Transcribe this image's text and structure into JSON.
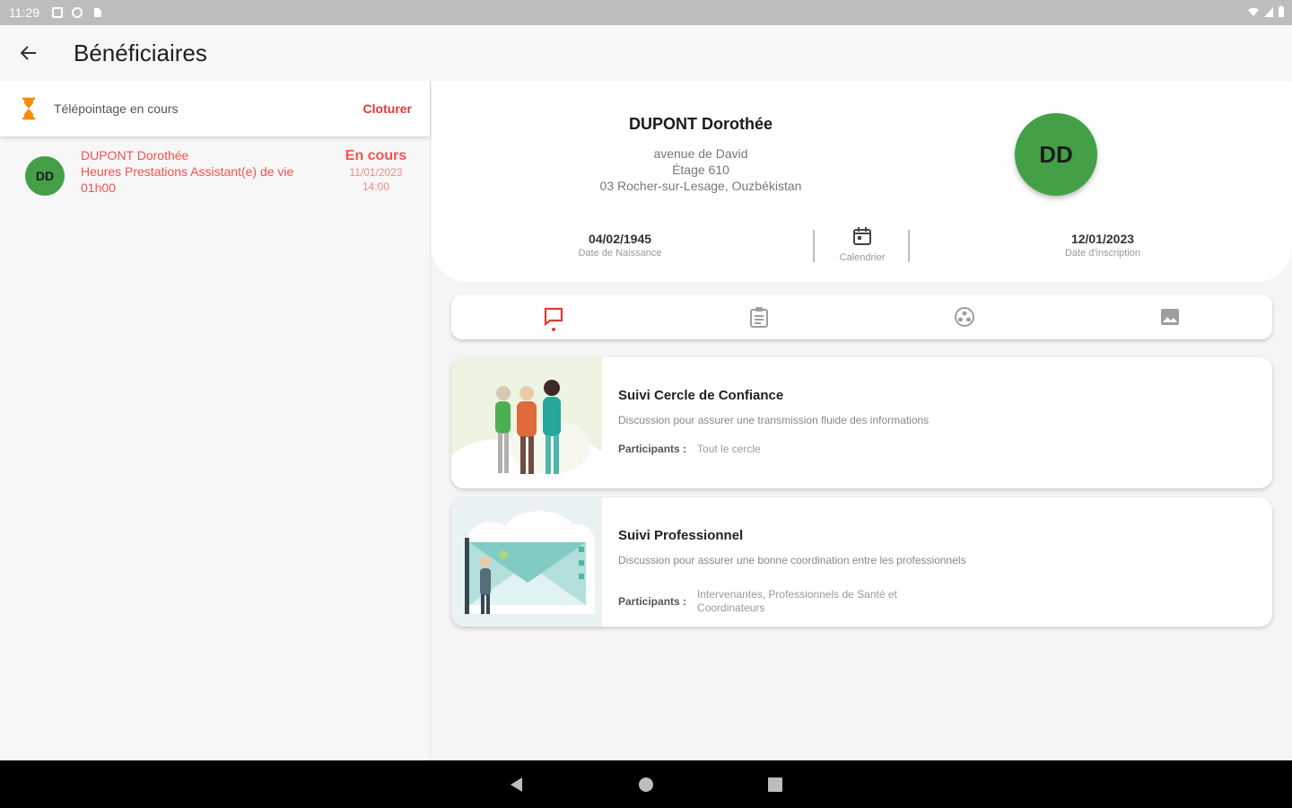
{
  "status_bar": {
    "time": "11:29"
  },
  "app_bar": {
    "title": "Bénéficiaires"
  },
  "pointage": {
    "label": "Télépointage en cours",
    "action": "Cloturer"
  },
  "beneficiary_list": [
    {
      "initials": "DD",
      "name": "DUPONT Dorothée",
      "service": "Heures Prestations Assistant(e) de vie",
      "duration": "01h00",
      "status": "En cours",
      "date": "11/01/2023",
      "time": "14:00"
    }
  ],
  "profile": {
    "name": "DUPONT Dorothée",
    "address_line1": "avenue de David",
    "address_line2": "Étage 610",
    "address_line3": "03 Rocher-sur-Lesage, Ouzbékistan",
    "initials": "DD",
    "birth_date": "04/02/1945",
    "birth_label": "Date de Naissance",
    "calendar_label": "Calendrier",
    "signup_date": "12/01/2023",
    "signup_label": "Date d'inscription"
  },
  "tabs": [
    {
      "icon": "chat-icon",
      "active": true
    },
    {
      "icon": "clipboard-icon",
      "active": false
    },
    {
      "icon": "network-icon",
      "active": false
    },
    {
      "icon": "image-icon",
      "active": false
    }
  ],
  "conversations": [
    {
      "title": "Suivi Cercle de Confiance",
      "description": "Discussion pour assurer une transmission fluide des informations",
      "participants_label": "Participants :",
      "participants": "Tout le cercle"
    },
    {
      "title": "Suivi Professionnel",
      "description": "Discussion pour assurer une bonne coordination entre les professionnels",
      "participants_label": "Participants :",
      "participants": "Intervenantes, Professionnels de Santé et Coordinateurs"
    }
  ],
  "colors": {
    "accent": "#e53935",
    "avatar": "#43a047",
    "timer": "#fb8c00"
  }
}
